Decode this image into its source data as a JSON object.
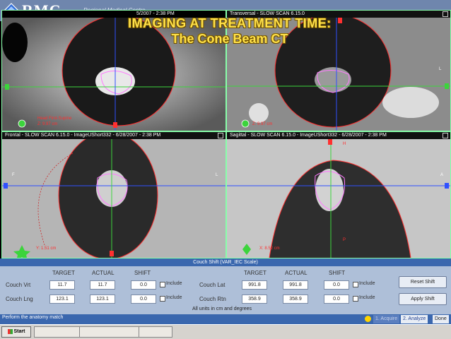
{
  "header": {
    "logo": "RMC",
    "logo_sub": "Regional Medical Centre",
    "title_line1": "IMAGING AT TREATMENT TIME:",
    "title_line2": "The Cone Beam CT",
    "partial_time": "5/2007 - 2:38 PM"
  },
  "panes": {
    "top_right_header": "Transversal - SLOW SCAN 6.15.0",
    "bottom_left_header": "Frontal - SLOW SCAN 6.15.0 - ImageUShort332 - 6/28/2007 - 2:38 PM",
    "bottom_right_header": "Sagittal - SLOW SCAN 6.15.0 - ImageUShort332 - 6/28/2007 - 2:38 PM",
    "top_left_orientation": "Head First-Supine",
    "top_left_z": "Z: 9.97 cm",
    "top_right_z": "Z: 9.97 cm",
    "bottom_left_y": "Y: 1.51 cm",
    "bottom_right_x": "X: 8.52 cm",
    "marker_l": "L",
    "marker_p": "P",
    "marker_h": "H",
    "marker_f": "F",
    "marker_a": "A"
  },
  "couch": {
    "title": "Couch Shift (VAR_IEC Scale)",
    "col_target": "TARGET",
    "col_actual": "ACTUAL",
    "col_shift": "SHIFT",
    "rows_left": [
      {
        "label": "Couch Vrt",
        "target": "11.7",
        "actual": "11.7",
        "shift": "0.0",
        "include": "Include"
      },
      {
        "label": "Couch Lng",
        "target": "123.1",
        "actual": "123.1",
        "shift": "0.0",
        "include": "Include"
      }
    ],
    "rows_right": [
      {
        "label": "Couch Lat",
        "target": "991.8",
        "actual": "991.8",
        "shift": "0.0",
        "include": "Include"
      },
      {
        "label": "Couch Rtn",
        "target": "358.9",
        "actual": "358.9",
        "shift": "0.0",
        "include": "Include"
      }
    ],
    "units_note": "All units in cm and degrees",
    "reset_label": "Reset Shift",
    "apply_label": "Apply Shift"
  },
  "status": {
    "message": "Perform the anatomy match",
    "step1": "1. Acquire",
    "step2": "2. Analyze",
    "done": "Done"
  },
  "taskbar": {
    "start": "Start"
  },
  "colors": {
    "title_yellow": "#ffe14a",
    "banner": "#6f86ad",
    "panel_bg": "#aebfd8",
    "status_blue": "#3a67ae",
    "crosshair_green": "#3cd43c",
    "crosshair_blue": "#3050ff",
    "contour_red": "#ff3030",
    "contour_pink": "#ff7aff"
  }
}
